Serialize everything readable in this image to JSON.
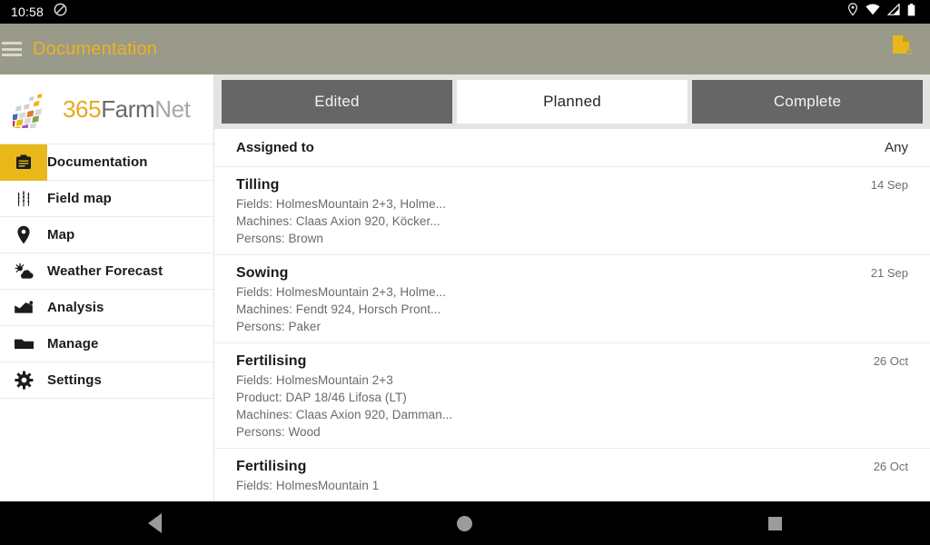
{
  "status_bar": {
    "clock": "10:58",
    "left_icons": [
      "do-not-disturb-icon"
    ],
    "right_icons": [
      "location-pin-icon",
      "wifi-icon",
      "cellular-signal-icon",
      "battery-icon"
    ]
  },
  "app_bar": {
    "title": "Documentation",
    "menu_icon": "hamburger-menu-icon",
    "action_icon": "add-document-icon",
    "background": "#9a9a8a",
    "title_color": "#edb21e"
  },
  "sidebar": {
    "brand": {
      "prefix": "365",
      "middle": "Farm",
      "suffix": "Net"
    },
    "items": [
      {
        "label": "Documentation",
        "icon": "clipboard-icon",
        "active": true
      },
      {
        "label": "Field map",
        "icon": "wheat-icon",
        "active": false
      },
      {
        "label": "Map",
        "icon": "map-pin-icon",
        "active": false
      },
      {
        "label": "Weather Forecast",
        "icon": "sun-cloud-icon",
        "active": false
      },
      {
        "label": "Analysis",
        "icon": "chart-icon",
        "active": false
      },
      {
        "label": "Manage",
        "icon": "folder-icon",
        "active": false
      },
      {
        "label": "Settings",
        "icon": "gear-icon",
        "active": false
      }
    ],
    "active_color": "#e8b81b"
  },
  "main": {
    "tabs": [
      {
        "label": "Edited",
        "selected": false
      },
      {
        "label": "Planned",
        "selected": true
      },
      {
        "label": "Complete",
        "selected": false
      }
    ],
    "assigned": {
      "label": "Assigned to",
      "value": "Any"
    },
    "entries": [
      {
        "title": "Tilling",
        "date": "14 Sep",
        "lines": [
          "Fields: HolmesMountain 2+3, Holme...",
          "Machines: Claas Axion 920, Köcker...",
          "Persons: Brown"
        ]
      },
      {
        "title": "Sowing",
        "date": "21 Sep",
        "lines": [
          "Fields: HolmesMountain 2+3, Holme...",
          "Machines: Fendt 924, Horsch Pront...",
          "Persons: Paker"
        ]
      },
      {
        "title": "Fertilising",
        "date": "26 Oct",
        "lines": [
          "Fields: HolmesMountain 2+3",
          "Product: DAP 18/46  Lifosa (LT)",
          "Machines: Claas Axion 920, Damman...",
          "Persons: Wood"
        ]
      },
      {
        "title": "Fertilising",
        "date": "26 Oct",
        "lines": [
          "Fields: HolmesMountain 1"
        ]
      }
    ]
  },
  "navbar": {
    "buttons": [
      {
        "name": "back-button",
        "icon": "triangle-back-icon"
      },
      {
        "name": "home-button",
        "icon": "circle-home-icon"
      },
      {
        "name": "recents-button",
        "icon": "square-recents-icon"
      }
    ]
  }
}
